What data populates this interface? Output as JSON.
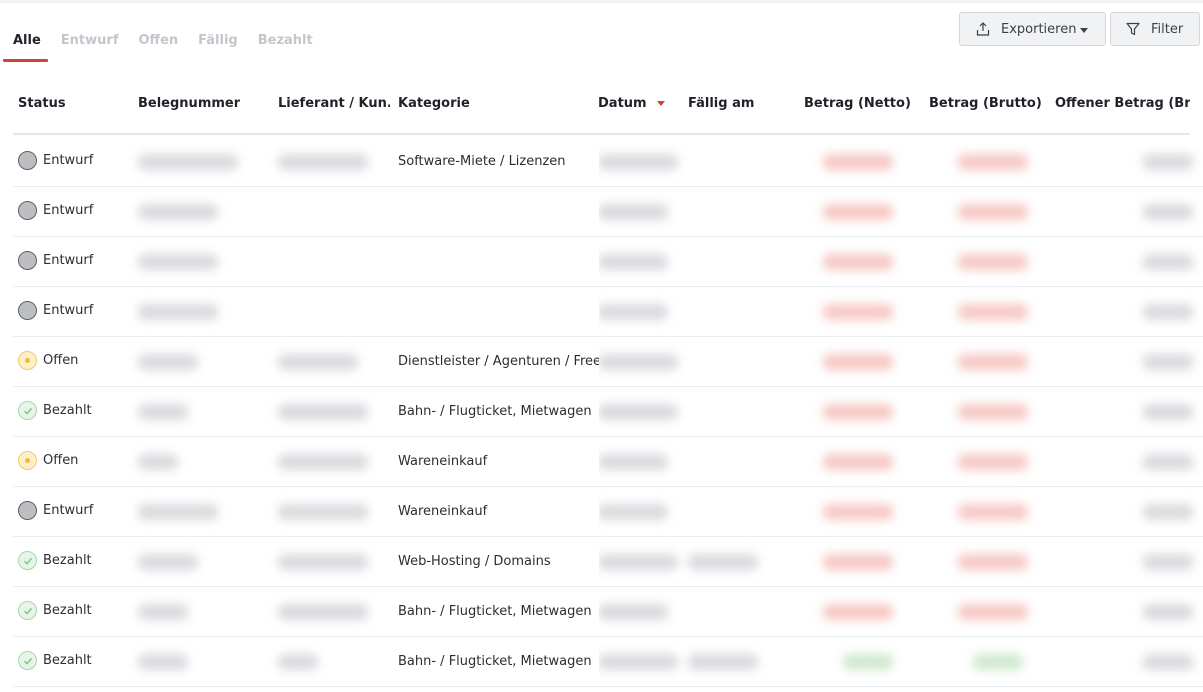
{
  "tabs": [
    {
      "label": "Alle",
      "active": true
    },
    {
      "label": "Entwurf",
      "active": false
    },
    {
      "label": "Offen",
      "active": false
    },
    {
      "label": "Fällig",
      "active": false
    },
    {
      "label": "Bezahlt",
      "active": false
    }
  ],
  "toolbar": {
    "export_label": "Exportieren",
    "export_icon": "upload-icon",
    "filter_label": "Filter",
    "filter_icon": "funnel-icon"
  },
  "columns": {
    "status": "Status",
    "belegnummer": "Belegnummer",
    "lieferant": "Lieferant / Kun...",
    "kategorie": "Kategorie",
    "datum": "Datum",
    "faellig": "Fällig am",
    "netto": "Betrag (Netto)",
    "brutto": "Betrag (Brutto)",
    "offen": "Offener Betrag (Brut"
  },
  "sort": {
    "column": "Datum",
    "direction": "descending"
  },
  "colors": {
    "accent": "#d0423a",
    "status_draft": "#bcbec1",
    "status_open": "#f2b838",
    "status_paid": "#7cc47f"
  },
  "rows": [
    {
      "status": "Entwurf",
      "kind": "draft",
      "kategorie": "Software-Miete / Lizenzen"
    },
    {
      "status": "Entwurf",
      "kind": "draft",
      "kategorie": ""
    },
    {
      "status": "Entwurf",
      "kind": "draft",
      "kategorie": ""
    },
    {
      "status": "Entwurf",
      "kind": "draft",
      "kategorie": ""
    },
    {
      "status": "Offen",
      "kind": "open",
      "kategorie": "Dienstleister / Agenturen / Freela"
    },
    {
      "status": "Bezahlt",
      "kind": "paid",
      "kategorie": "Bahn- / Flugticket, Mietwagen"
    },
    {
      "status": "Offen",
      "kind": "open",
      "kategorie": "Wareneinkauf"
    },
    {
      "status": "Entwurf",
      "kind": "draft",
      "kategorie": "Wareneinkauf"
    },
    {
      "status": "Bezahlt",
      "kind": "paid",
      "kategorie": "Web-Hosting / Domains"
    },
    {
      "status": "Bezahlt",
      "kind": "paid",
      "kategorie": "Bahn- / Flugticket, Mietwagen"
    },
    {
      "status": "Bezahlt",
      "kind": "paid",
      "kategorie": "Bahn- / Flugticket, Mietwagen"
    }
  ]
}
